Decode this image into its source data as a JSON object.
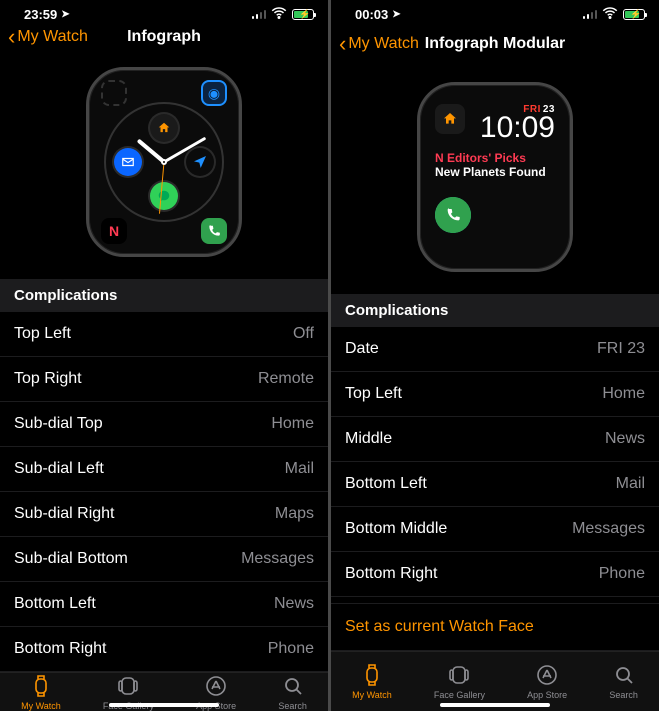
{
  "left": {
    "status": {
      "time": "23:59"
    },
    "nav": {
      "back": "My Watch",
      "title": "Infograph"
    },
    "section": "Complications",
    "rows": [
      {
        "label": "Top Left",
        "value": "Off"
      },
      {
        "label": "Top Right",
        "value": "Remote"
      },
      {
        "label": "Sub-dial Top",
        "value": "Home"
      },
      {
        "label": "Sub-dial Left",
        "value": "Mail"
      },
      {
        "label": "Sub-dial Right",
        "value": "Maps"
      },
      {
        "label": "Sub-dial Bottom",
        "value": "Messages"
      },
      {
        "label": "Bottom Left",
        "value": "News"
      },
      {
        "label": "Bottom Right",
        "value": "Phone"
      }
    ],
    "tabs": [
      {
        "label": "My Watch",
        "icon": "watch-outline-icon",
        "active": true
      },
      {
        "label": "Face Gallery",
        "icon": "face-gallery-icon",
        "active": false
      },
      {
        "label": "App Store",
        "icon": "app-store-icon",
        "active": false
      },
      {
        "label": "Search",
        "icon": "search-icon",
        "active": false
      }
    ]
  },
  "right": {
    "status": {
      "time": "00:03"
    },
    "nav": {
      "back": "My Watch",
      "title": "Infograph Modular"
    },
    "preview": {
      "date_weekday": "FRI",
      "date_day": "23",
      "time": "10:09",
      "news_source_prefix": "↳",
      "news_headline": "Editors' Picks",
      "news_sub": "New Planets Found"
    },
    "section": "Complications",
    "rows": [
      {
        "label": "Date",
        "value": "FRI 23"
      },
      {
        "label": "Top Left",
        "value": "Home"
      },
      {
        "label": "Middle",
        "value": "News"
      },
      {
        "label": "Bottom Left",
        "value": "Mail"
      },
      {
        "label": "Bottom Middle",
        "value": "Messages"
      },
      {
        "label": "Bottom Right",
        "value": "Phone"
      }
    ],
    "action": "Set as current Watch Face",
    "tabs": [
      {
        "label": "My Watch",
        "icon": "watch-outline-icon",
        "active": true
      },
      {
        "label": "Face Gallery",
        "icon": "face-gallery-icon",
        "active": false
      },
      {
        "label": "App Store",
        "icon": "app-store-icon",
        "active": false
      },
      {
        "label": "Search",
        "icon": "search-icon",
        "active": false
      }
    ]
  },
  "icons": {
    "home": "⌂",
    "mail": "✉",
    "maps": "➤",
    "messages": "●",
    "news": "N",
    "phone": "✆",
    "remote": "◉"
  }
}
